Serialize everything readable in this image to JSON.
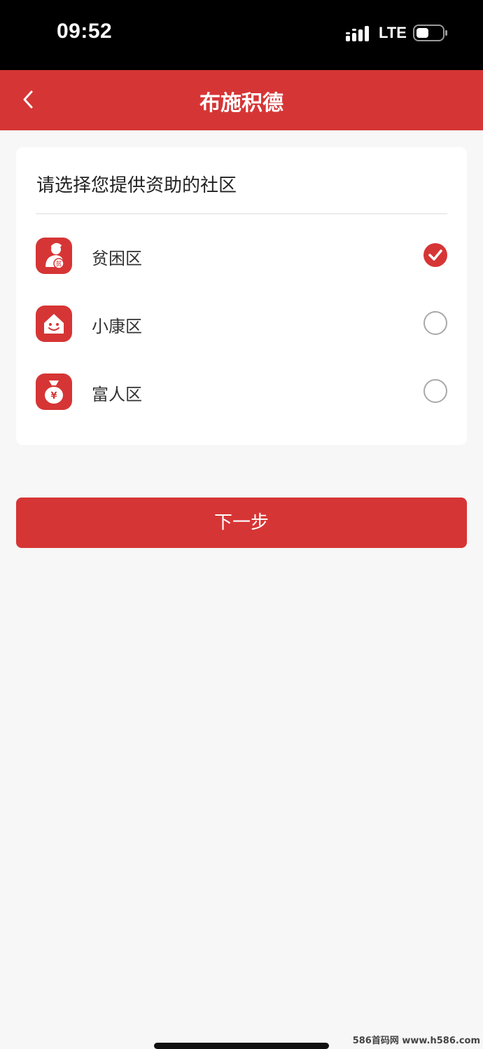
{
  "status_bar": {
    "time": "09:52",
    "network": "LTE",
    "icons": [
      "signal-bars-icon",
      "battery-icon"
    ]
  },
  "nav": {
    "title": "布施积德",
    "back_icon": "chevron-left-icon",
    "bg_color": "#d63535"
  },
  "card": {
    "title": "请选择您提供资助的社区",
    "options": [
      {
        "label": "贫困区",
        "icon": "poverty-person-icon",
        "icon_text": "贫",
        "selected": true
      },
      {
        "label": "小康区",
        "icon": "smiling-house-icon",
        "selected": false
      },
      {
        "label": "富人区",
        "icon": "money-bag-icon",
        "icon_text": "¥",
        "selected": false
      }
    ]
  },
  "next_button": {
    "label": "下一步"
  },
  "watermark": "586首码网 www.h586.com",
  "colors": {
    "accent": "#d63535",
    "background": "#f7f7f7"
  }
}
